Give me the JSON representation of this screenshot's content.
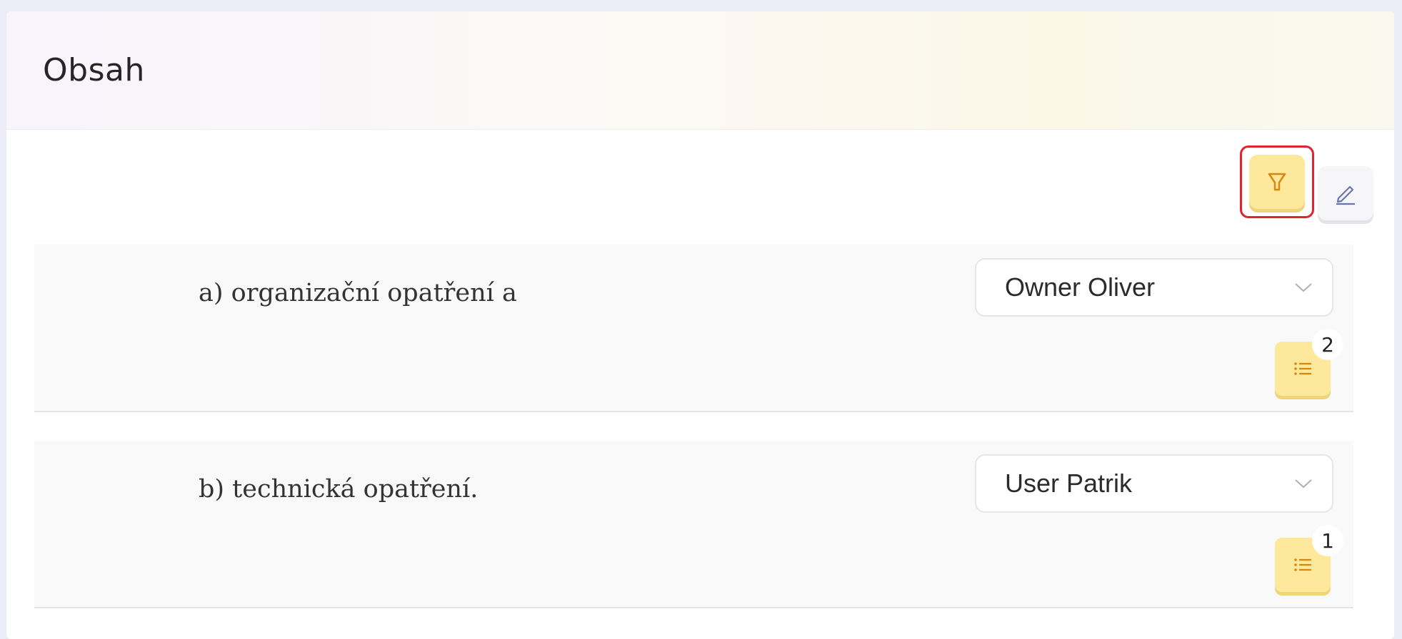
{
  "card": {
    "title": "Obsah"
  },
  "toolbar": {
    "filter_icon": "filter-icon",
    "edit_icon": "pencil-icon",
    "accent_color": "#fde89b",
    "highlight_color": "#e0232e"
  },
  "rows": [
    {
      "text": "a) organizační opatření a",
      "assignee": "Owner Oliver",
      "list_count": "2"
    },
    {
      "text": "b) technická opatření.",
      "assignee": "User Patrik",
      "list_count": "1"
    }
  ]
}
